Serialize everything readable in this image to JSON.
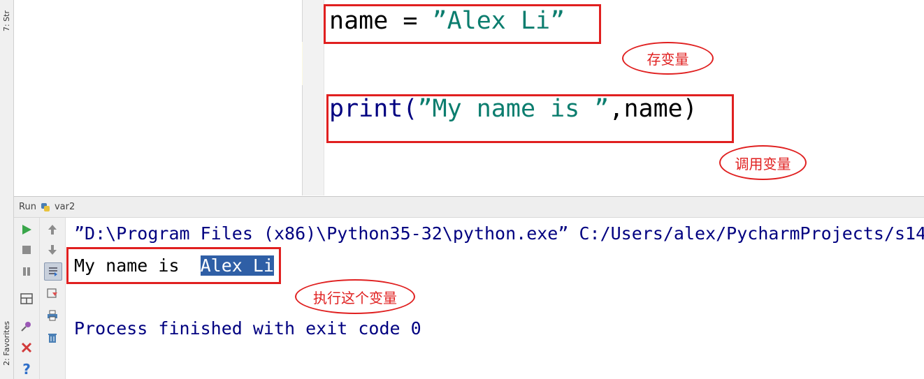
{
  "sidebar": {
    "structure_tab": "7: Str",
    "favorites_tab": "2: Favorites"
  },
  "editor": {
    "line1": {
      "ident": "name",
      "op": " = ",
      "string": "”Alex Li”"
    },
    "line2": {
      "func": "print(",
      "string": "”My name is ”",
      "rest": ",name)"
    }
  },
  "annotations": {
    "store_variable": "存变量",
    "call_variable": "调用变量",
    "execute_variable": "执行这个变量"
  },
  "run": {
    "label": "Run",
    "config_name": "var2"
  },
  "console": {
    "command_line": "”D:\\Program Files (x86)\\Python35-32\\python.exe” C:/Users/alex/PycharmProjects/s14",
    "output_prefix": "My name is  ",
    "output_selected": "Alex Li",
    "exit_message": "Process finished with exit code 0"
  },
  "colors": {
    "annotation_red": "#e02020",
    "string_teal": "#0b7d6e",
    "console_blue": "#000080",
    "selection": "#2f5fa6"
  }
}
